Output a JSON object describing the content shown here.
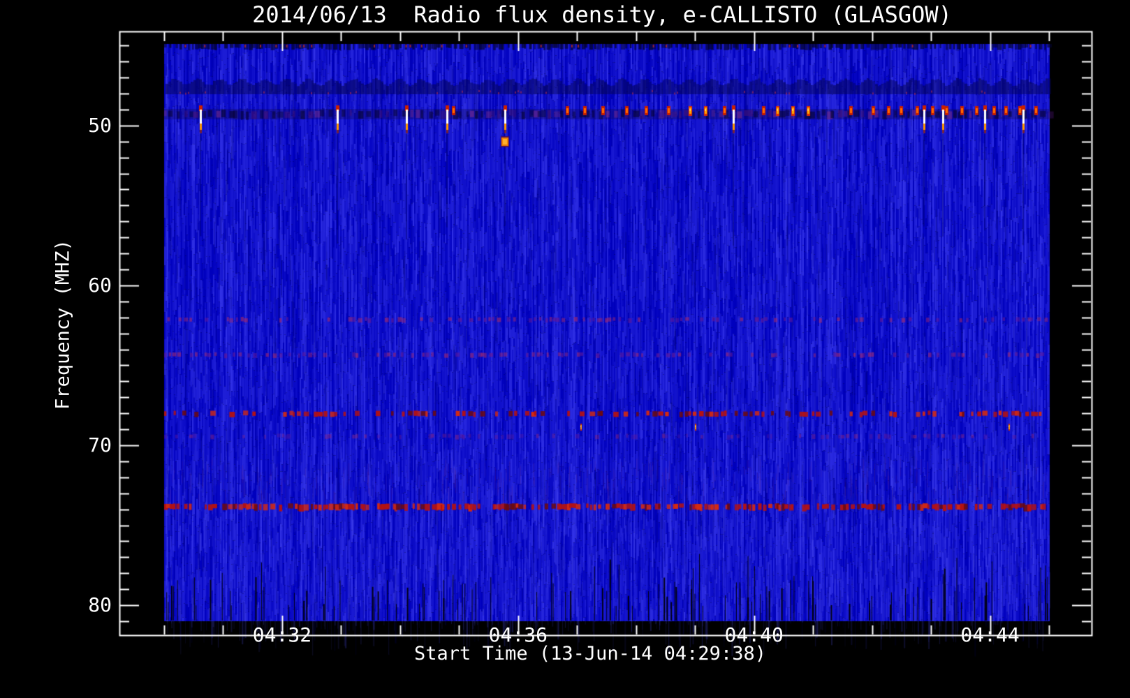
{
  "chart_data": {
    "type": "heatmap",
    "title": "2014/06/13  Radio flux density, e-CALLISTO (GLASGOW)",
    "xlabel": "Start Time (13-Jun-14 04:29:38)",
    "ylabel": "Frequency (MHZ)",
    "station": "GLASGOW",
    "date": "2014/06/13",
    "start_time": "04:29:38",
    "x_axis": {
      "tick_labels": [
        "04:32",
        "04:36",
        "04:40",
        "04:44"
      ],
      "major_tick_minutes": [
        2,
        6,
        10,
        14
      ],
      "minor_tick_minutes": [
        0,
        1,
        2,
        3,
        4,
        5,
        6,
        7,
        8,
        9,
        10,
        11,
        12,
        13,
        14,
        15
      ],
      "minutes_origin": "04:30:00"
    },
    "y_axis": {
      "tick_labels": [
        "50",
        "60",
        "70",
        "80"
      ],
      "major_tick_mhz": [
        50,
        60,
        70,
        80
      ],
      "minor_tick_step_mhz": 1,
      "range_mhz": [
        44.1,
        81.8
      ]
    },
    "image_extent": {
      "t_min": 0,
      "t_max": 15,
      "f_top_mhz": 44.9,
      "f_bottom_mhz": 81.0
    },
    "colormap": {
      "background_blue": "#1212cd",
      "streak_light_blue": "#3c3ce6",
      "streak_dark_blue": "#000078",
      "band_red": "#b41212",
      "band_purple": "#5c1c96",
      "burst_red": "#c81e00",
      "burst_orange": "#ffaa00",
      "burst_white": "#ffffff",
      "dropout_black": "#000008",
      "frame_white": "#ffffff"
    },
    "interference_bands": [
      {
        "f_mhz": 45.0,
        "style": "top-edge-dashes",
        "note": "dark dashes with red specks along top edge"
      },
      {
        "f_mhz": 47.6,
        "style": "dark-wavy",
        "note": "scalloped darker band, ~32px period"
      },
      {
        "f_mhz": 49.3,
        "style": "dark-channel",
        "note": "dark/purple dashed channel where bursts sit"
      },
      {
        "f_mhz": 62.1,
        "style": "purple-dashes",
        "note": "faint purple/red dash row"
      },
      {
        "f_mhz": 64.3,
        "style": "purple-dashes",
        "note": "faint purple/red dash row"
      },
      {
        "f_mhz": 68.0,
        "style": "red-dashes",
        "note": "bright red dash row"
      },
      {
        "f_mhz": 69.4,
        "style": "purple-dashes-faint",
        "note": "very faint purple dash row"
      },
      {
        "f_mhz": 73.8,
        "style": "red-dashes-dense",
        "note": "dense bright red dash row"
      }
    ],
    "bursts_50mhz": [
      {
        "t": 0.62,
        "level": "white"
      },
      {
        "t": 2.94,
        "level": "white"
      },
      {
        "t": 4.11,
        "level": "white"
      },
      {
        "t": 4.8,
        "level": "white"
      },
      {
        "t": 4.9,
        "level": "red"
      },
      {
        "t": 5.78,
        "level": "white"
      },
      {
        "t": 6.83,
        "level": "red"
      },
      {
        "t": 7.13,
        "level": "red"
      },
      {
        "t": 7.43,
        "level": "red"
      },
      {
        "t": 7.84,
        "level": "red"
      },
      {
        "t": 8.17,
        "level": "red"
      },
      {
        "t": 8.55,
        "level": "red"
      },
      {
        "t": 8.91,
        "level": "orange"
      },
      {
        "t": 9.17,
        "level": "orange"
      },
      {
        "t": 9.49,
        "level": "red"
      },
      {
        "t": 9.65,
        "level": "white"
      },
      {
        "t": 10.16,
        "level": "red"
      },
      {
        "t": 10.39,
        "level": "orange"
      },
      {
        "t": 10.65,
        "level": "orange"
      },
      {
        "t": 10.91,
        "level": "orange"
      },
      {
        "t": 11.64,
        "level": "red"
      },
      {
        "t": 12.02,
        "level": "red"
      },
      {
        "t": 12.28,
        "level": "red"
      },
      {
        "t": 12.49,
        "level": "red"
      },
      {
        "t": 12.76,
        "level": "red"
      },
      {
        "t": 12.88,
        "level": "white"
      },
      {
        "t": 13.02,
        "level": "red"
      },
      {
        "t": 13.2,
        "level": "white"
      },
      {
        "t": 13.26,
        "level": "red"
      },
      {
        "t": 13.52,
        "level": "red"
      },
      {
        "t": 13.77,
        "level": "red"
      },
      {
        "t": 13.91,
        "level": "white"
      },
      {
        "t": 14.06,
        "level": "red"
      },
      {
        "t": 14.27,
        "level": "red"
      },
      {
        "t": 14.5,
        "level": "red"
      },
      {
        "t": 14.56,
        "level": "white"
      },
      {
        "t": 14.77,
        "level": "red"
      }
    ],
    "orange_blob": {
      "t": 5.78,
      "f_mhz": 51.0
    },
    "minor_orange_spots_68_9mhz": [
      7.07,
      9.01,
      14.33
    ],
    "dropout_lines": {
      "f_top_mhz": 78.3,
      "f_bottom_mhz": 81.0,
      "count": 115
    }
  }
}
